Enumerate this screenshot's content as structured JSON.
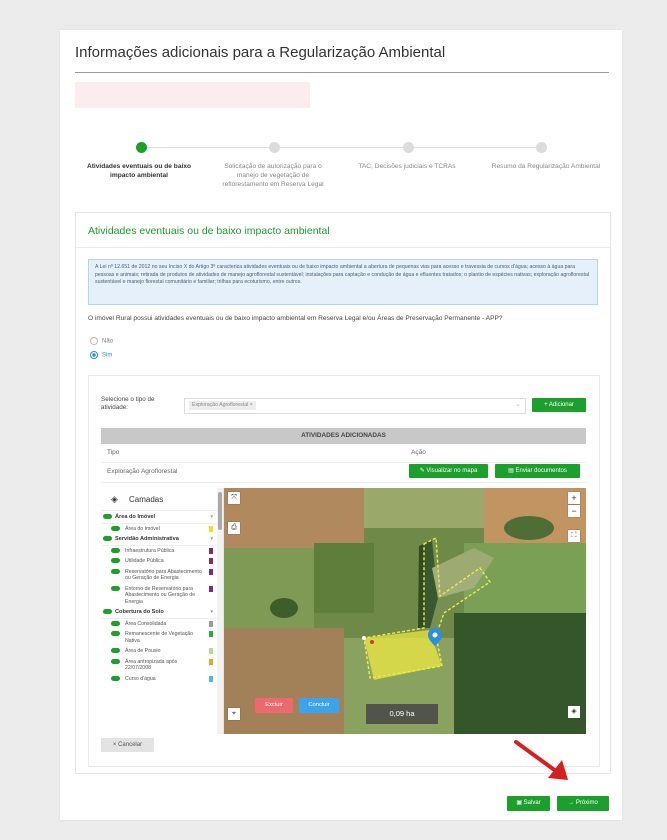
{
  "page": {
    "title": "Informações adicionais para a Regularização Ambiental"
  },
  "stepper": {
    "steps": [
      {
        "label": "Atividades eventuais ou de baixo impacto ambiental",
        "active": true
      },
      {
        "label": "Solicitação de autorização para o manejo de vegetação de reflorestamento em Reserva Legal",
        "active": false
      },
      {
        "label": "TAC, Decisões judiciais e TCRAs",
        "active": false
      },
      {
        "label": "Resumo da Regularização Ambiental",
        "active": false
      }
    ]
  },
  "section": {
    "title": "Atividades eventuais ou de baixo impacto ambiental",
    "info_text": "A Lei nº 12.651 de 2012 no seu Inciso X do Artigo 3º caracteriza atividades eventuais ou de baixo impacto ambiental a abertura de pequenas vias para acesso e travessia de cursos d'água; acesso à água para pessoas e animais; retirada de produtos de atividades de manejo agroflorestal sustentável; instalações para captação e condução de água e efluentes tratados; o plantio de espécies nativas; exploração agroflorestal sustentável e manejo florestal comunitário e familiar; trilhas para ecoturismo, entre outros.",
    "question": "O imóvel Rural possui atividades eventuais ou de baixo impacto ambiental em Reserva Legal e/ou Áreas de Preservação Permanente - APP?",
    "option_no": "Não",
    "option_yes": "Sim",
    "selected": "Sim"
  },
  "activity_form": {
    "select_label": "Selecione o tipo de atividade:",
    "selected_chip": "Exploração Agroflorestal",
    "chip_remove": "×",
    "dropdown_caret": "⌄",
    "add_button": "+ Adicionar"
  },
  "activities_table": {
    "header": "ATIVIDADES ADICIONADAS",
    "col_type": "Tipo",
    "col_action": "Ação",
    "rows": [
      {
        "type": "Exploração Agroflorestal",
        "view_button": "Visualizar no mapa",
        "docs_button": "Enviar documentos"
      }
    ]
  },
  "layers_panel": {
    "title": "Camadas",
    "groups": [
      {
        "name": "Área do Imóvel",
        "items": [
          {
            "label": "Área do Imóvel",
            "color": "#f2d92a"
          }
        ]
      },
      {
        "name": "Servidão Administrativa",
        "items": [
          {
            "label": "Infraestrutura Pública",
            "color": "#8a2a55"
          },
          {
            "label": "Utilidade Pública",
            "color": "#8a2a55"
          },
          {
            "label": "Reservatório para Abastecimento ou Geração de Energia",
            "color": "#7a2a8a"
          },
          {
            "label": "Entorno de Reservatório para Abastecimento ou Geração de Energia",
            "color": "#7a2a8a"
          }
        ]
      },
      {
        "name": "Cobertura do Solo",
        "items": [
          {
            "label": "Área Consolidada",
            "color": "#9a9a9a"
          },
          {
            "label": "Remanescente de Vegetação Nativa",
            "color": "#2aa84a"
          },
          {
            "label": "Área de Pousio",
            "color": "#b8d88a"
          },
          {
            "label": "Área antropizada após 22/07/2008",
            "color": "#f0a030"
          },
          {
            "label": "Curso d'água",
            "color": "#5ab0f0"
          }
        ]
      }
    ]
  },
  "map": {
    "zoom_in": "+",
    "zoom_out": "−",
    "area_label": "0,09 ha",
    "delete_button": "Excluir",
    "finish_button": "Concluir"
  },
  "buttons": {
    "cancel": "× Cancelar",
    "save": "Salvar",
    "next": "→ Próximo"
  },
  "colors": {
    "accent_green": "#1c9f2c",
    "danger": "#ec6a6e",
    "primary_blue": "#3ba3ed",
    "annotation_arrow": "#d42020"
  }
}
